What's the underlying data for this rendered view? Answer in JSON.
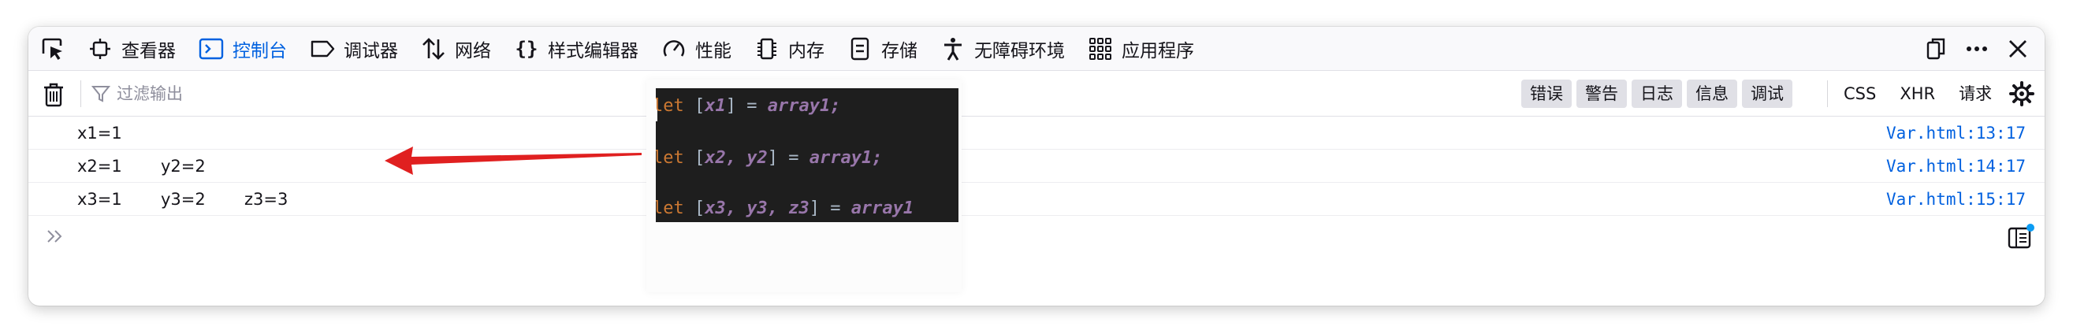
{
  "tabs": [
    {
      "label": "查看器",
      "icon": "inspector-icon",
      "active": false
    },
    {
      "label": "控制台",
      "icon": "console-icon",
      "active": true
    },
    {
      "label": "调试器",
      "icon": "debugger-icon",
      "active": false
    },
    {
      "label": "网络",
      "icon": "network-icon",
      "active": false
    },
    {
      "label": "样式编辑器",
      "icon": "style-editor-icon",
      "active": false
    },
    {
      "label": "性能",
      "icon": "performance-icon",
      "active": false
    },
    {
      "label": "内存",
      "icon": "memory-icon",
      "active": false
    },
    {
      "label": "存储",
      "icon": "storage-icon",
      "active": false
    },
    {
      "label": "无障碍环境",
      "icon": "accessibility-icon",
      "active": false
    },
    {
      "label": "应用程序",
      "icon": "application-icon",
      "active": false
    }
  ],
  "filter": {
    "placeholder": "过滤输出"
  },
  "levels": [
    "错误",
    "警告",
    "日志",
    "信息",
    "调试"
  ],
  "net_filters": [
    "CSS",
    "XHR",
    "请求"
  ],
  "rows": [
    {
      "values": [
        "x1=1"
      ],
      "source": "Var.html:13:17"
    },
    {
      "values": [
        "x2=1",
        "y2=2"
      ],
      "source": "Var.html:14:17"
    },
    {
      "values": [
        "x3=1",
        "y3=2",
        "z3=3"
      ],
      "source": "Var.html:15:17"
    }
  ],
  "code_overlay": {
    "lines": [
      {
        "kw": "let",
        "open": " [",
        "vars": "x1",
        "close": "] = ",
        "rhs": "array1;"
      },
      {
        "kw": "let",
        "open": " [",
        "vars": "x2, y2",
        "close": "] = ",
        "rhs": "array1;"
      },
      {
        "kw": "let",
        "open": " [",
        "vars": "x3, y3, z3",
        "close": "] = ",
        "rhs": "array1"
      }
    ]
  },
  "colors": {
    "accent": "#0061e0",
    "source_link": "#0060df",
    "arrow": "#e02020",
    "code_bg": "#1e1e1e",
    "keyword": "#cc7832",
    "variable": "#9876aa"
  }
}
